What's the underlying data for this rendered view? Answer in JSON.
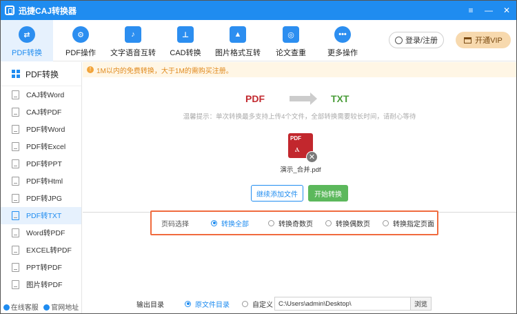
{
  "app": {
    "title": "迅捷CAJ转换器"
  },
  "window": {
    "menu": "≡",
    "minimize": "—",
    "close": "✕"
  },
  "toolbar": {
    "tools": [
      {
        "label": "PDF转换",
        "icon": "⇄",
        "active": true
      },
      {
        "label": "PDF操作",
        "icon": "⚙"
      },
      {
        "label": "文字语音互转",
        "icon": "♪"
      },
      {
        "label": "CAD转换",
        "icon": "⊥"
      },
      {
        "label": "图片格式互转",
        "icon": "▲"
      },
      {
        "label": "论文查重",
        "icon": "◎"
      },
      {
        "label": "更多操作",
        "icon": "•••"
      }
    ],
    "login_label": "登录/注册",
    "vip_label": "开通VIP"
  },
  "sidebar": {
    "header": "PDF转换",
    "items": [
      "CAJ转Word",
      "CAJ转PDF",
      "PDF转Word",
      "PDF转Excel",
      "PDF转PPT",
      "PDF转Html",
      "PDF转JPG",
      "PDF转TXT",
      "Word转PDF",
      "EXCEL转PDF",
      "PPT转PDF",
      "图片转PDF"
    ],
    "active_item": "PDF转TXT",
    "footer_service": "在线客服",
    "footer_site": "官网地址"
  },
  "notice": {
    "text": "1M以内的免费转换，大于1M的需购买注册。"
  },
  "conversion": {
    "from": "PDF",
    "to": "TXT"
  },
  "tip": "温馨提示：单次转换最多支持上传4个文件，全部转换需要较长时间，请耐心等待",
  "file": {
    "type": "PDF",
    "name": "演示_合并.pdf"
  },
  "buttons": {
    "add_file": "继续添加文件",
    "start": "开始转换"
  },
  "page_select": {
    "label": "页码选择",
    "options": [
      "转换全部",
      "转换奇数页",
      "转换偶数页",
      "转换指定页面"
    ],
    "selected": "转换全部"
  },
  "output": {
    "label": "输出目录",
    "opt_source": "原文件目录",
    "opt_custom": "自定义",
    "selected": "原文件目录",
    "path": "C:\\Users\\admin\\Desktop\\",
    "browse_label": "浏览"
  }
}
